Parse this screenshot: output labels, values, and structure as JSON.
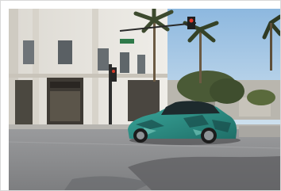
{
  "photo": {
    "subject": "camouflaged-prototype-car-photo",
    "colors": {
      "sky": "#9fc3e3",
      "building": "#e7e4dd",
      "road": "#8b8c8f",
      "car_body": "#2f9a8f",
      "palm": "#3d4a2e"
    }
  }
}
